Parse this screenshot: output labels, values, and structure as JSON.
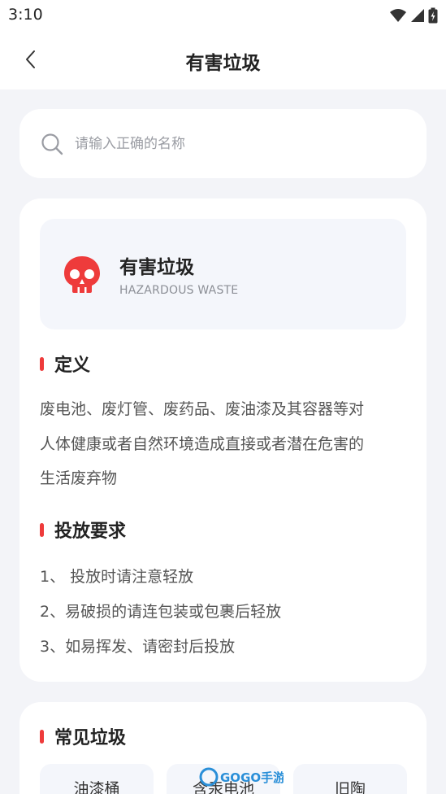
{
  "status": {
    "time": "3:10"
  },
  "header": {
    "title": "有害垃圾"
  },
  "search": {
    "placeholder": "请输入正确的名称"
  },
  "category": {
    "name": "有害垃圾",
    "name_en": "HAZARDOUS WASTE",
    "icon": "skull-icon",
    "accent": "#ee3b3b"
  },
  "definition": {
    "heading": "定义",
    "lines": [
      "废电池、废灯管、废药品、废油漆及其容器等对",
      "人体健康或者自然环境造成直接或者潜在危害的",
      "生活废弃物"
    ]
  },
  "requirements": {
    "heading": "投放要求",
    "items": [
      "1、 投放时请注意轻放",
      "2、易破损的请连包装或包裹后轻放",
      "3、如易挥发、请密封后投放"
    ]
  },
  "common": {
    "heading": "常见垃圾",
    "items": [
      "油漆桶",
      "含汞电池",
      "旧陶"
    ]
  },
  "watermark": {
    "text": "GOGO手游网"
  }
}
